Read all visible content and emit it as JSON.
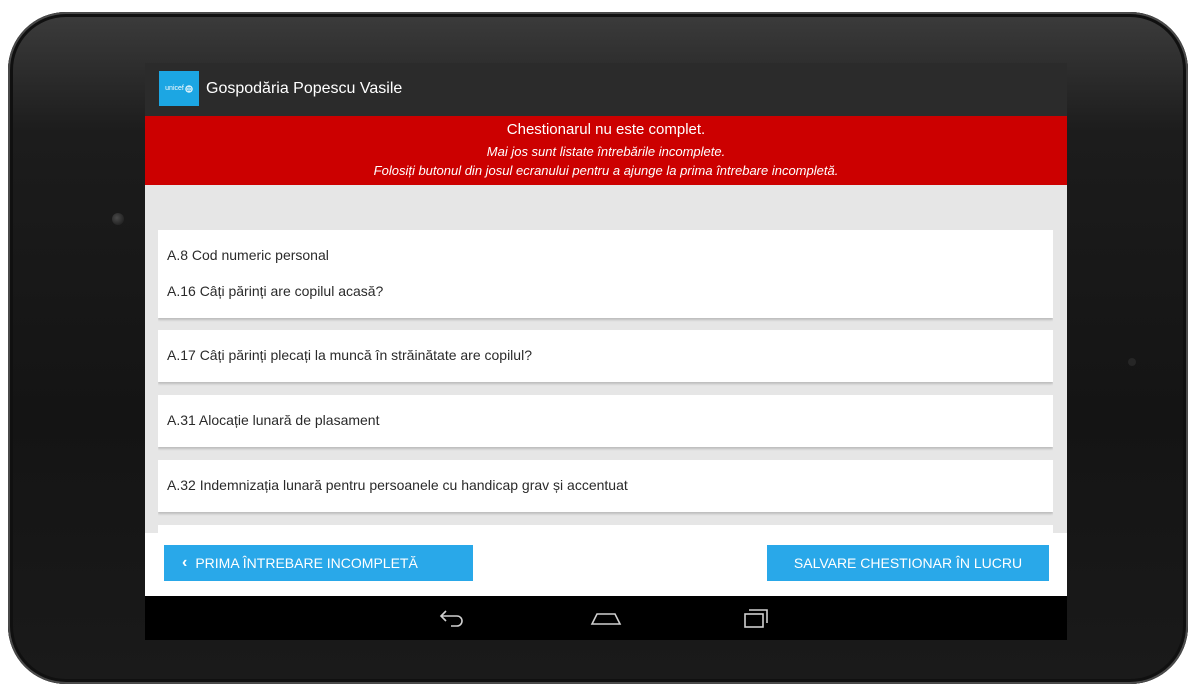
{
  "app": {
    "logo_text": "unicef",
    "title": "Gospodăria Popescu Vasile"
  },
  "alert": {
    "title": "Chestionarul nu este complet.",
    "line1": "Mai jos sunt listate întrebările incomplete.",
    "line2": "Folosiți butonul din josul ecranului pentru a ajunge la prima întrebare incompletă.",
    "color": "#cc0000"
  },
  "questions": [
    "A.8 Cod numeric personal",
    "A.16 Câți părinți are copilul acasă?",
    "A.17 Câți părinți plecați la muncă în străinătate are copilul?",
    "A.31 Alocație lunară de plasament",
    "A.32 Indemnizația lunară pentru persoanele cu handicap grav și accentuat"
  ],
  "buttons": {
    "first_incomplete": "PRIMA ÎNTREBARE INCOMPLETĂ",
    "save_in_progress": "SALVARE CHESTIONAR ÎN LUCRU",
    "accent": "#29a8e9"
  },
  "nav": {
    "icons": [
      "back-icon",
      "home-icon",
      "recent-apps-icon"
    ]
  }
}
